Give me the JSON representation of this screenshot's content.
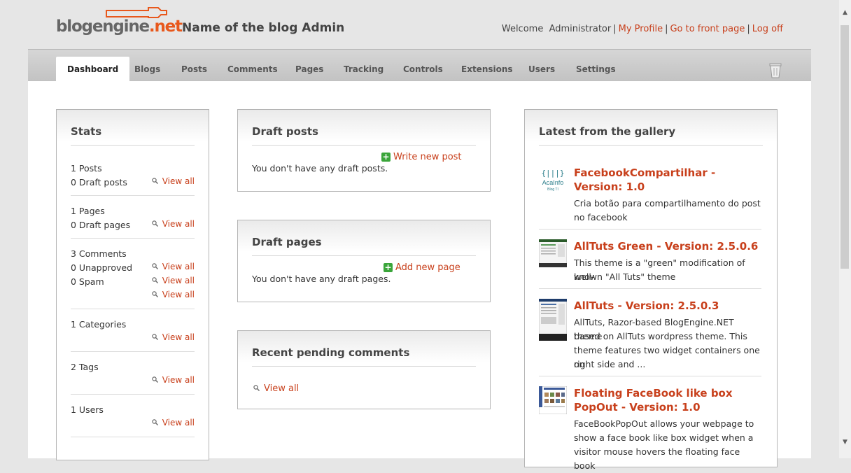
{
  "header": {
    "logo_text_a": "blogengine",
    "logo_text_b": ".net",
    "blog_title": "Name of the blog Admin",
    "welcome": "Welcome",
    "user": "Administrator",
    "separator": "|",
    "links": [
      "My Profile",
      "Go to front page",
      "Log off"
    ]
  },
  "nav": {
    "tabs": [
      "Dashboard",
      "Blogs",
      "Posts",
      "Comments",
      "Pages",
      "Tracking",
      "Controls",
      "Extensions",
      "Users",
      "Settings"
    ],
    "active": "Dashboard",
    "trash_icon": "trash-icon"
  },
  "stats": {
    "title": "Stats",
    "view_all": "View all",
    "lines": [
      "1 Posts",
      "0 Draft posts",
      "1 Pages",
      "0 Draft pages",
      "3 Comments",
      "0 Unapproved",
      "0 Spam",
      "1 Categories",
      "2 Tags",
      "1 Users"
    ]
  },
  "draft_posts": {
    "title": "Draft posts",
    "action": "Write new post",
    "message": "You don't have any draft posts."
  },
  "draft_pages": {
    "title": "Draft pages",
    "action": "Add new page",
    "message": "You don't have any draft pages."
  },
  "pending_comments": {
    "title": "Recent pending comments",
    "view_all": "View all"
  },
  "gallery": {
    "title": "Latest from the gallery",
    "items": [
      {
        "title": "FacebookCompartilhar - Version: 1.0",
        "desc": [
          "Cria botão para compartilhamento do post",
          "no facebook"
        ],
        "thumb_text": [
          "AcaInfo",
          "Blog TI"
        ]
      },
      {
        "title": "AllTuts Green - Version: 2.5.0.6",
        "desc": [
          "This theme is a \"green\" modification of well-",
          "known \"All Tuts\" theme"
        ]
      },
      {
        "title": "AllTuts - Version: 2.5.0.3",
        "desc": [
          "AllTuts, Razor-based BlogEngine.NET theme",
          "based on AllTuts wordpress theme. This",
          "theme features two widget containers one on",
          "right side and ..."
        ]
      },
      {
        "title": "Floating FaceBook like box PopOut - Version: 1.0",
        "desc": [
          "FaceBookPopOut allows your webpage to",
          "show a face book like box widget when a",
          "visitor mouse hovers the floating face book"
        ]
      }
    ]
  },
  "colors": {
    "accent": "#c8401c",
    "plus_green": "#3aa53a"
  }
}
